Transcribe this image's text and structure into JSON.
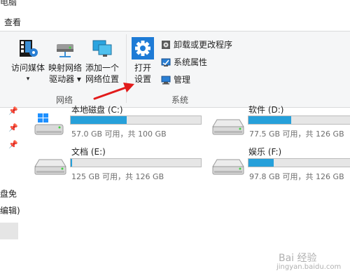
{
  "window": {
    "partial_title": "电脑"
  },
  "menu": {
    "view_tab": "查看"
  },
  "ribbon": {
    "network_group": {
      "label": "网络",
      "buttons": [
        {
          "line1": "访问媒体",
          "line2": "▾",
          "icon": "media-icon"
        },
        {
          "line1": "映射网络",
          "line2": "驱动器 ▾",
          "icon": "network-drive-icon"
        },
        {
          "line1": "添加一个",
          "line2": "网络位置",
          "icon": "network-location-icon"
        }
      ]
    },
    "system_group": {
      "label": "系统",
      "open_settings": {
        "line1": "打开",
        "line2": "设置",
        "icon": "gear-icon"
      },
      "small_commands": [
        {
          "label": "卸载或更改程序",
          "icon": "uninstall-icon"
        },
        {
          "label": "系统属性",
          "icon": "system-properties-icon"
        },
        {
          "label": "管理",
          "icon": "manage-icon"
        }
      ]
    }
  },
  "drives": [
    {
      "name": "本地磁盘 (C:)",
      "size": "57.0 GB 可用，共 100 GB",
      "used_fraction": 0.43
    },
    {
      "name": "软件 (D:)",
      "size": "77.5 GB 可用，共 126 GB",
      "used_fraction": 0.385
    },
    {
      "name": "文档 (E:)",
      "size": "125 GB 可用，共 126 GB",
      "used_fraction": 0.01
    },
    {
      "name": "娱乐 (F:)",
      "size": "97.8 GB 可用，共 126 GB",
      "used_fraction": 0.225
    }
  ],
  "sidebar": {
    "partial_item_1": "盘免",
    "partial_item_2": "编辑)"
  },
  "watermark": {
    "line1": "Bai 经验",
    "line2": "jingyan.baidu.com"
  },
  "colors": {
    "accent": "#26a0da",
    "arrow": "#e21b1b",
    "ribbon_bg": "#f5f6f7"
  }
}
